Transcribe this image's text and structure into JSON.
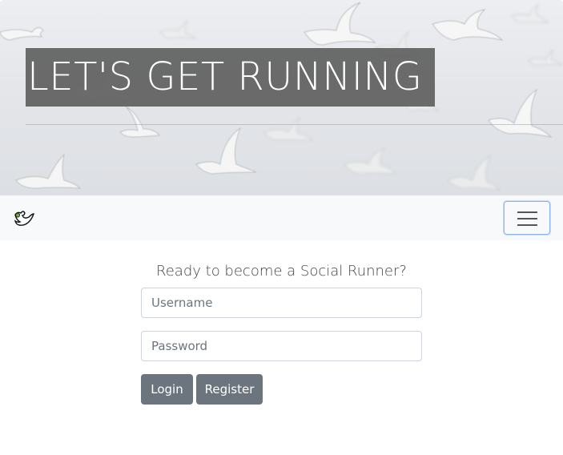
{
  "hero": {
    "title": "LET'S GET RUNNING ."
  },
  "navbar": {
    "brand_icon": "dove-icon",
    "toggler_icon": "hamburger-menu-icon"
  },
  "form": {
    "prompt": "Ready to become a Social Runner?",
    "username_placeholder": "Username",
    "password_placeholder": "Password",
    "login_label": "Login",
    "register_label": "Register"
  },
  "colors": {
    "button_bg": "#6c757d",
    "navbar_bg": "#f8f9fa",
    "title_box": "#5f5f5f",
    "toggler_border": "#8db4f0"
  }
}
